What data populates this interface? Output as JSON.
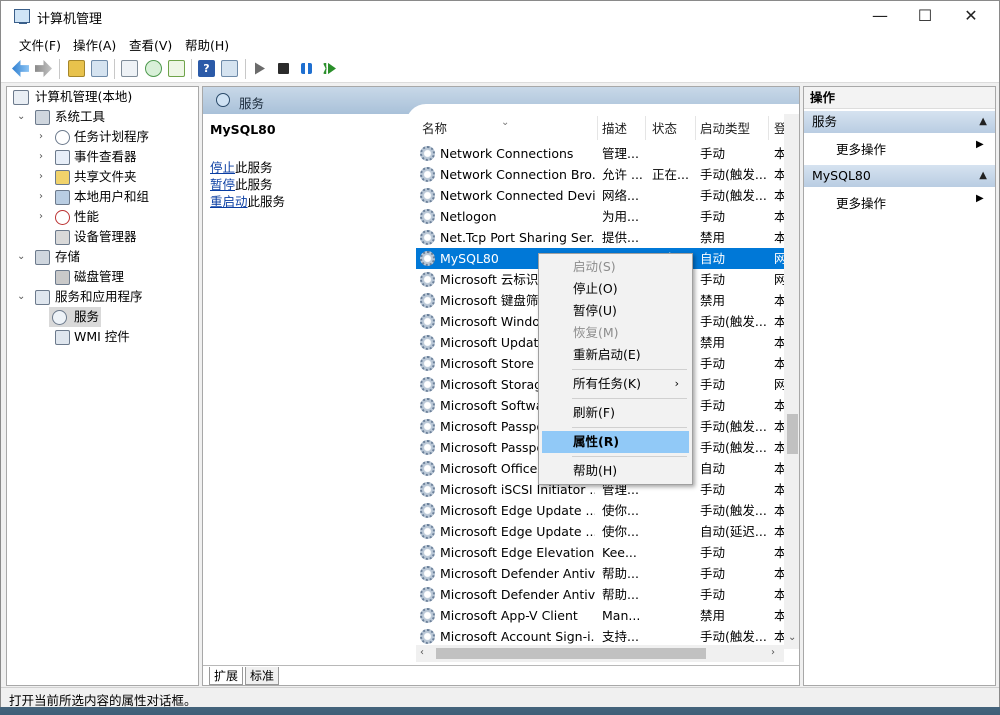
{
  "window": {
    "title": "计算机管理",
    "buttons": {
      "minimize": "—",
      "maximize": "☐",
      "close": "✕"
    }
  },
  "menubar": [
    "文件(F)",
    "操作(A)",
    "查看(V)",
    "帮助(H)"
  ],
  "tree": [
    {
      "label": "计算机管理(本地)",
      "arrow": ""
    },
    {
      "label": "系统工具",
      "arrow": "⌄"
    },
    {
      "label": "任务计划程序",
      "arrow": "›"
    },
    {
      "label": "事件查看器",
      "arrow": "›"
    },
    {
      "label": "共享文件夹",
      "arrow": "›"
    },
    {
      "label": "本地用户和组",
      "arrow": "›"
    },
    {
      "label": "性能",
      "arrow": "›"
    },
    {
      "label": "设备管理器",
      "arrow": ""
    },
    {
      "label": "存储",
      "arrow": "⌄"
    },
    {
      "label": "磁盘管理",
      "arrow": ""
    },
    {
      "label": "服务和应用程序",
      "arrow": "⌄"
    },
    {
      "label": "服务",
      "arrow": ""
    },
    {
      "label": "WMI 控件",
      "arrow": ""
    }
  ],
  "services_panel": {
    "header": "服务",
    "selected_name": "MySQL80",
    "actions": [
      {
        "link": "停止",
        "rest": "此服务"
      },
      {
        "link": "暂停",
        "rest": "此服务"
      },
      {
        "link": "重启动",
        "rest": "此服务"
      }
    ],
    "columns": [
      "名称",
      "描述",
      "状态",
      "启动类型",
      "登"
    ],
    "rows": [
      {
        "name": "Network Connections",
        "desc": "管理...",
        "status": "",
        "startup": "手动",
        "logon": "本"
      },
      {
        "name": "Network Connection Bro...",
        "desc": "允许 ...",
        "status": "正在...",
        "startup": "手动(触发...",
        "logon": "本"
      },
      {
        "name": "Network Connected Devi...",
        "desc": "网络...",
        "status": "",
        "startup": "手动(触发...",
        "logon": "本"
      },
      {
        "name": "Netlogon",
        "desc": "为用...",
        "status": "",
        "startup": "手动",
        "logon": "本"
      },
      {
        "name": "Net.Tcp Port Sharing Ser...",
        "desc": "提供...",
        "status": "",
        "startup": "禁用",
        "logon": "本"
      },
      {
        "name": "MySQL80",
        "desc": "",
        "status": "正在...",
        "startup": "自动",
        "logon": "网"
      },
      {
        "name": "Microsoft 云标识服",
        "desc": "",
        "status": "",
        "startup": "手动",
        "logon": "网"
      },
      {
        "name": "Microsoft 键盘筛选",
        "desc": "",
        "status": "",
        "startup": "禁用",
        "logon": "本"
      },
      {
        "name": "Microsoft Windov",
        "desc": "",
        "status": "",
        "startup": "手动(触发...",
        "logon": "本"
      },
      {
        "name": "Microsoft Update",
        "desc": "",
        "status": "",
        "startup": "禁用",
        "logon": "本"
      },
      {
        "name": "Microsoft Store 安",
        "desc": "",
        "status": "",
        "startup": "手动",
        "logon": "本"
      },
      {
        "name": "Microsoft Storage",
        "desc": "",
        "status": "",
        "startup": "手动",
        "logon": "网"
      },
      {
        "name": "Microsoft Softwar",
        "desc": "",
        "status": "",
        "startup": "手动",
        "logon": "本"
      },
      {
        "name": "Microsoft Passpo",
        "desc": "",
        "status": "",
        "startup": "手动(触发...",
        "logon": "本"
      },
      {
        "name": "Microsoft Passpo",
        "desc": "",
        "status": "",
        "startup": "手动(触发...",
        "logon": "本"
      },
      {
        "name": "Microsoft Office E",
        "desc": "",
        "status": "",
        "startup": "自动",
        "logon": "本"
      },
      {
        "name": "Microsoft iSCSI Initiator ...",
        "desc": "管理...",
        "status": "",
        "startup": "手动",
        "logon": "本"
      },
      {
        "name": "Microsoft Edge Update ...",
        "desc": "使你...",
        "status": "",
        "startup": "手动(触发...",
        "logon": "本"
      },
      {
        "name": "Microsoft Edge Update ...",
        "desc": "使你...",
        "status": "",
        "startup": "自动(延迟...",
        "logon": "本"
      },
      {
        "name": "Microsoft Edge Elevation...",
        "desc": "Kee...",
        "status": "",
        "startup": "手动",
        "logon": "本"
      },
      {
        "name": "Microsoft Defender Antiv...",
        "desc": "帮助...",
        "status": "",
        "startup": "手动",
        "logon": "本"
      },
      {
        "name": "Microsoft Defender Antiv...",
        "desc": "帮助...",
        "status": "",
        "startup": "手动",
        "logon": "本"
      },
      {
        "name": "Microsoft App-V Client",
        "desc": "Man...",
        "status": "",
        "startup": "禁用",
        "logon": "本"
      },
      {
        "name": "Microsoft Account Sign-i...",
        "desc": "支持...",
        "status": "",
        "startup": "手动(触发...",
        "logon": "本"
      }
    ],
    "tabs": [
      "扩展",
      "标准"
    ]
  },
  "actions_pane": {
    "title": "操作",
    "sections": [
      {
        "header": "服务",
        "item": "更多操作"
      },
      {
        "header": "MySQL80",
        "item": "更多操作"
      }
    ]
  },
  "context_menu": [
    {
      "label": "启动(S)",
      "disabled": true
    },
    {
      "label": "停止(O)",
      "disabled": false
    },
    {
      "label": "暂停(U)",
      "disabled": false
    },
    {
      "label": "恢复(M)",
      "disabled": true
    },
    {
      "label": "重新启动(E)",
      "disabled": false
    },
    {
      "label": "所有任务(K)",
      "disabled": false,
      "submenu": true
    },
    {
      "label": "刷新(F)",
      "disabled": false
    },
    {
      "label": "属性(R)",
      "disabled": false,
      "highlighted": true
    },
    {
      "label": "帮助(H)",
      "disabled": false
    }
  ],
  "status_bar": "打开当前所选内容的属性对话框。"
}
